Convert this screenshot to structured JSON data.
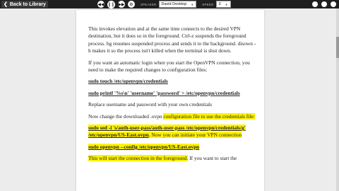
{
  "toolbar": {
    "back_label": "Back to Library",
    "prev_icon": "rewind-icon",
    "play_icon": "pause-icon",
    "next_icon": "fast-forward-icon",
    "speaker_label": "SPEAKER",
    "speaker_value": "David Desktop",
    "speed_label": "SPEED",
    "speed_value": "3",
    "dark_color": "#1f1f1f"
  },
  "document": {
    "p1": "This invokes elevation and at the same time connects to the desired VPN destination, but it does so in the foreground. Ctrl-z suspends the foreground process. bg resumes suspended process and sends it to the background. disown -h makes it so the process isn't killed when the terminal is shut down.",
    "p2": "If you want an automatic login when you start the OpenVPN connection, you need to make the required changes to configuration files:",
    "cmd1": "sudo touch /etc/openvpn/credentials",
    "cmd2": "sudo printf '%s\\n' 'username' 'password' > /etc/openvpn/credentials",
    "p3": "Replace username and password with your own credentials",
    "p4_pre": "Now change the downloaded .ovpn ",
    "p4_hl": "configuration file to use the credentials file:",
    "cmd3_hl": "sudo sed -i 's/auth-user-pass/auth-user-pass /etc/openvpn/credentials/g' /etc/openvpn/US-East.ovpn",
    "cmd3_tail": ". Now you can initiate your VPN connection",
    "cmd4": "sudo openvpn --config /etc/openvpn/US-East.ovpn",
    "p5_hl": "This will start the connection in the foreground.",
    "p5_tail": " If you want to start the",
    "highlight_color": "#fff200"
  }
}
